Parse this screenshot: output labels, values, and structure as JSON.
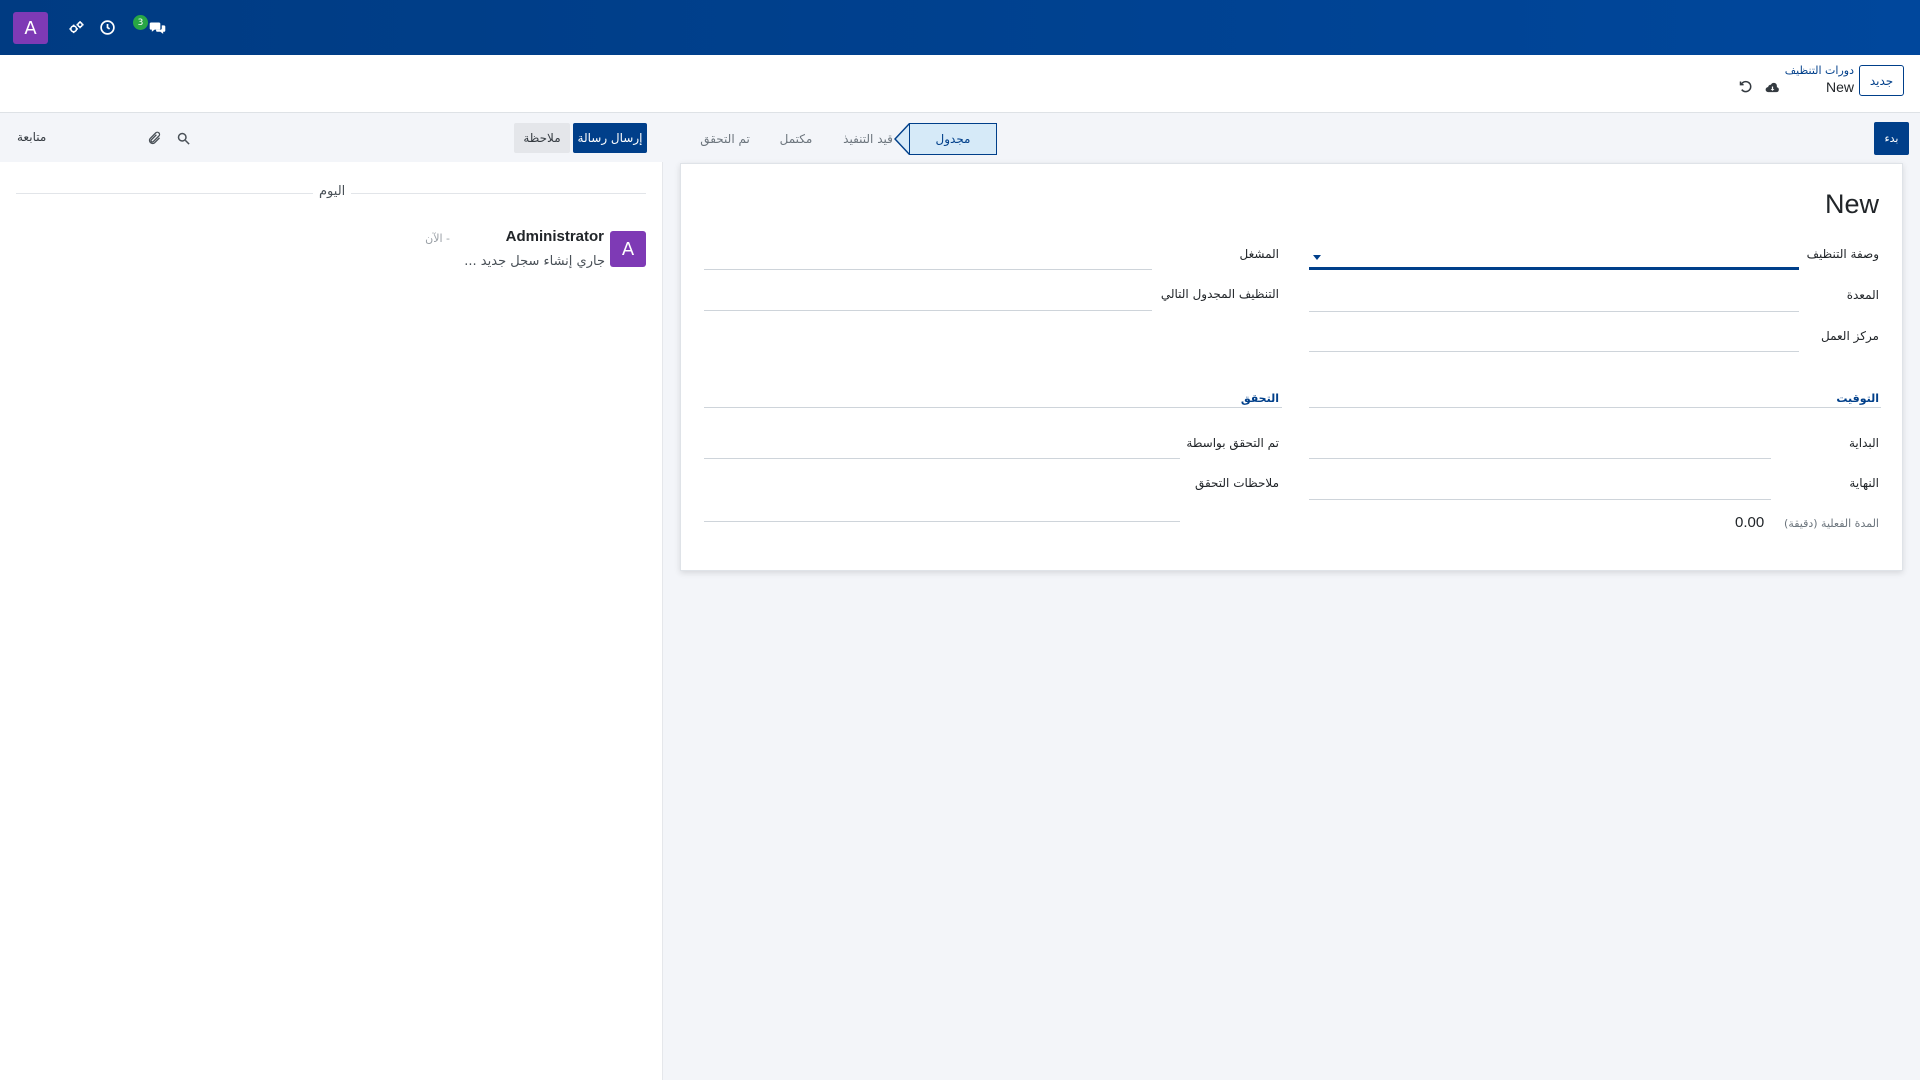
{
  "navbar": {
    "avatar_letter": "A",
    "messages_count": "3",
    "colors": {
      "bg": "#00479c",
      "avatar": "#7e3ab5",
      "badge": "#28a745"
    }
  },
  "control_panel": {
    "new_button": "جديد",
    "breadcrumb_parent": "دورات التنظيف",
    "breadcrumb_current": "New"
  },
  "chatter": {
    "send_message": "إرسال رسالة",
    "log_note": "ملاحظة",
    "follow": "متابعة",
    "today": "اليوم",
    "message": {
      "avatar_letter": "A",
      "author": "Administrator",
      "time": "- الآن",
      "body": "جاري إنشاء سجل جديد ..."
    }
  },
  "statusbar": {
    "start_button": "بدء",
    "stages": [
      {
        "label": "مجدول",
        "active": true
      },
      {
        "label": "قيد التنفيذ",
        "active": false
      },
      {
        "label": "مكتمل",
        "active": false
      },
      {
        "label": "تم التحقق",
        "active": false
      }
    ]
  },
  "form": {
    "title": "New",
    "fields": {
      "recipe": "وصفة التنظيف",
      "equipment": "المعدة",
      "workcenter": "مركز العمل",
      "operator": "المشغل",
      "next_cleaning": "التنظيف المجدول التالي"
    },
    "timing": {
      "title": "التوقيت",
      "start": "البداية",
      "end": "النهاية",
      "duration_label": "المدة الفعلية (دقيقة)",
      "duration_value": "0.00"
    },
    "verification": {
      "title": "التحقق",
      "verified_by": "تم التحقق بواسطة",
      "notes": "ملاحظات التحقق"
    }
  }
}
